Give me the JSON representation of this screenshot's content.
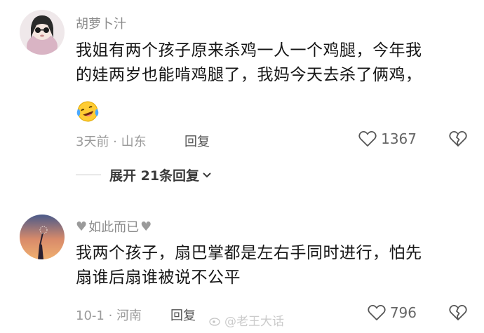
{
  "comments": [
    {
      "username": "胡萝卜汁",
      "content_lines": [
        "我姐有两个孩子原来杀鸡一人一个鸡腿，今年我",
        "的娃两岁也能啃鸡腿了，我妈今天去杀了俩鸡，"
      ],
      "emoji": "laughing-crying-emoji",
      "meta": "3天前 · 山东",
      "reply_label": "回复",
      "likes": "1367",
      "expand_label": "展开 21条回复"
    },
    {
      "username": "如此而已",
      "content_lines": [
        "我两个孩子，扇巴掌都是左右手同时进行，怕先",
        "扇谁后扇谁被说不公平"
      ],
      "meta": "10-1 · 河南",
      "reply_label": "回复",
      "likes": "796"
    }
  ],
  "watermark": "@老王大话",
  "colors": {
    "text": "#161616",
    "secondary": "#9a9a9a",
    "username": "#8a8a8a"
  }
}
